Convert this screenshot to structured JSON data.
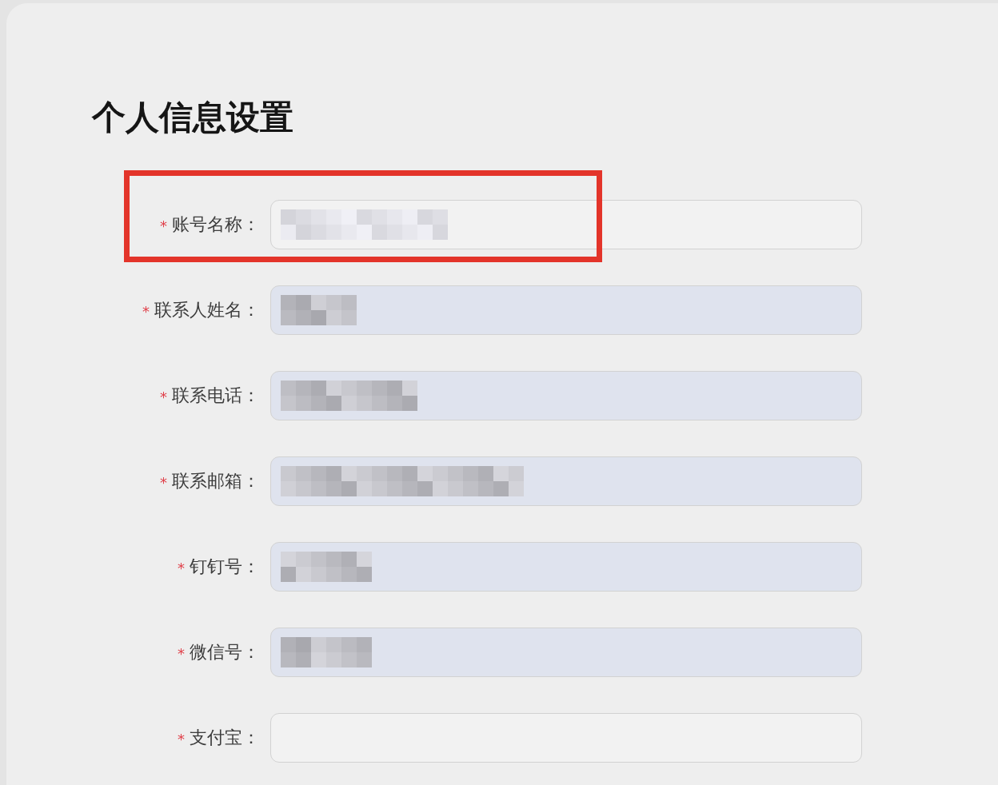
{
  "page": {
    "title": "个人信息设置"
  },
  "fields": [
    {
      "mark": "*",
      "label": "账号名称：",
      "autofilled": false,
      "value_pixelated": true,
      "highlighted": true
    },
    {
      "mark": "*",
      "label": "联系人姓名：",
      "autofilled": true,
      "value_pixelated": true,
      "highlighted": false
    },
    {
      "mark": "*",
      "label": "联系电话：",
      "autofilled": true,
      "value_pixelated": true,
      "highlighted": false
    },
    {
      "mark": "*",
      "label": "联系邮箱：",
      "autofilled": true,
      "value_pixelated": true,
      "highlighted": false
    },
    {
      "mark": "*",
      "label": "钉钉号：",
      "autofilled": true,
      "value_pixelated": true,
      "highlighted": false
    },
    {
      "mark": "*",
      "label": "微信号：",
      "autofilled": true,
      "value_pixelated": true,
      "highlighted": false
    },
    {
      "mark": "*",
      "label": "支付宝：",
      "autofilled": false,
      "value_pixelated": false,
      "highlighted": false
    }
  ]
}
